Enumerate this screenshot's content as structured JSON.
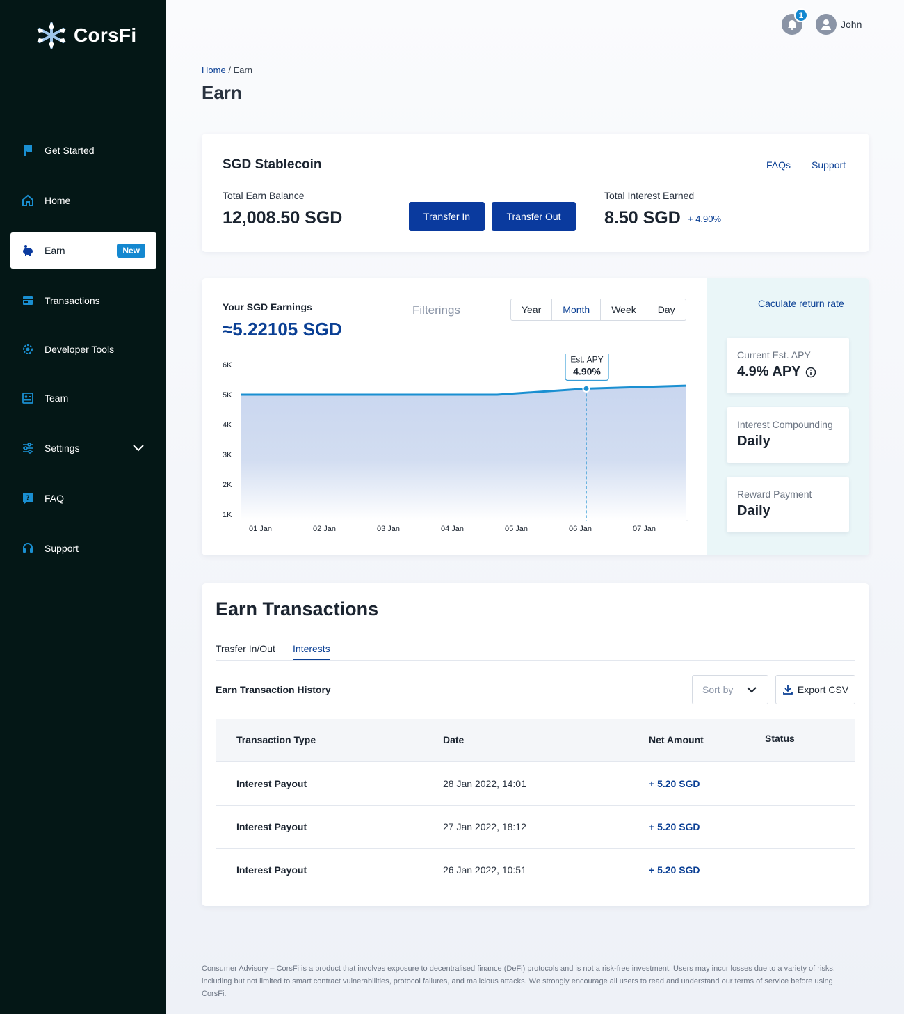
{
  "brand": {
    "name": "CorsFi"
  },
  "sidebar": {
    "items": [
      {
        "label": "Get Started",
        "icon": "flag-icon"
      },
      {
        "label": "Home",
        "icon": "home-icon"
      },
      {
        "label": "Earn",
        "icon": "piggy-bank-icon",
        "badge": "New",
        "active": true
      },
      {
        "label": "Transactions",
        "icon": "card-icon"
      },
      {
        "label": "Developer Tools",
        "icon": "gear-icon"
      },
      {
        "label": "Team",
        "icon": "id-card-icon"
      },
      {
        "label": "Settings",
        "icon": "sliders-icon",
        "has_dropdown": true
      },
      {
        "label": "FAQ",
        "icon": "question-icon"
      },
      {
        "label": "Support",
        "icon": "headset-icon"
      }
    ]
  },
  "topbar": {
    "notifications": "1",
    "username": "John"
  },
  "breadcrumb": {
    "home": "Home",
    "sep": "/",
    "current": "Earn"
  },
  "page_title": "Earn",
  "stablecoin": {
    "title": "SGD Stablecoin",
    "faqs": "FAQs",
    "support": "Support",
    "balance_label": "Total Earn Balance",
    "balance_value": "12,008.50 SGD",
    "transfer_in": "Transfer In",
    "transfer_out": "Transfer Out",
    "interest_label": "Total Interest Earned",
    "interest_value": "8.50 SGD",
    "interest_change": "+ 4.90%"
  },
  "earnings": {
    "label": "Your SGD Earnings",
    "value": "≈5.22105 SGD",
    "filter_label": "Filterings",
    "filters": [
      "Year",
      "Month",
      "Week",
      "Day"
    ],
    "selected_filter": "Month",
    "calc_link": "Caculate return rate",
    "tooltip_title": "Est. APY",
    "tooltip_value": "4.90%",
    "stats": [
      {
        "label": "Current Est. APY",
        "value": "4.9% APY",
        "info": true
      },
      {
        "label": "Interest Compounding",
        "value": "Daily"
      },
      {
        "label": "Reward Payment",
        "value": "Daily"
      }
    ]
  },
  "chart_data": {
    "type": "area",
    "x": [
      "01 Jan",
      "02 Jan",
      "03 Jan",
      "04 Jan",
      "05 Jan",
      "06 Jan",
      "07 Jan"
    ],
    "yticks": [
      "6K",
      "5K",
      "4K",
      "3K",
      "2K",
      "1K"
    ],
    "ylim": [
      1000,
      6000
    ],
    "series": [
      {
        "values": [
          5000,
          5000,
          5000,
          5000,
          5000,
          5200,
          5300
        ]
      }
    ],
    "highlight_index": 5,
    "color": "#1a8fd1",
    "fill": "#c9d6ef"
  },
  "transactions": {
    "title": "Earn Transactions",
    "tabs": [
      "Trasfer In/Out",
      "Interests"
    ],
    "selected_tab": "Interests",
    "history_label": "Earn Transaction History",
    "sort_placeholder": "Sort by",
    "export": "Export CSV",
    "columns": [
      "Transaction Type",
      "Date",
      "Net Amount",
      "Status"
    ],
    "rows": [
      {
        "type": "Interest Payout",
        "date": "28 Jan 2022, 14:01",
        "amount": "+ 5.20 SGD",
        "status": ""
      },
      {
        "type": "Interest Payout",
        "date": "27 Jan 2022, 18:12",
        "amount": "+ 5.20 SGD",
        "status": ""
      },
      {
        "type": "Interest Payout",
        "date": "26 Jan 2022, 10:51",
        "amount": "+ 5.20 SGD",
        "status": ""
      }
    ]
  },
  "disclaimer": "Consumer Advisory – CorsFi is a product that involves exposure to decentralised finance (DeFi) protocols and is not a risk-free investment. Users may incur losses due to a variety of risks, including but not limited to smart contract vulnerabilities, protocol failures, and malicious attacks. We strongly encourage all users to read and understand our terms of service before using CorsFi.",
  "colors": {
    "sidebar_bg": "#041716",
    "primary": "#0a3a9e",
    "accent": "#1488d0"
  }
}
